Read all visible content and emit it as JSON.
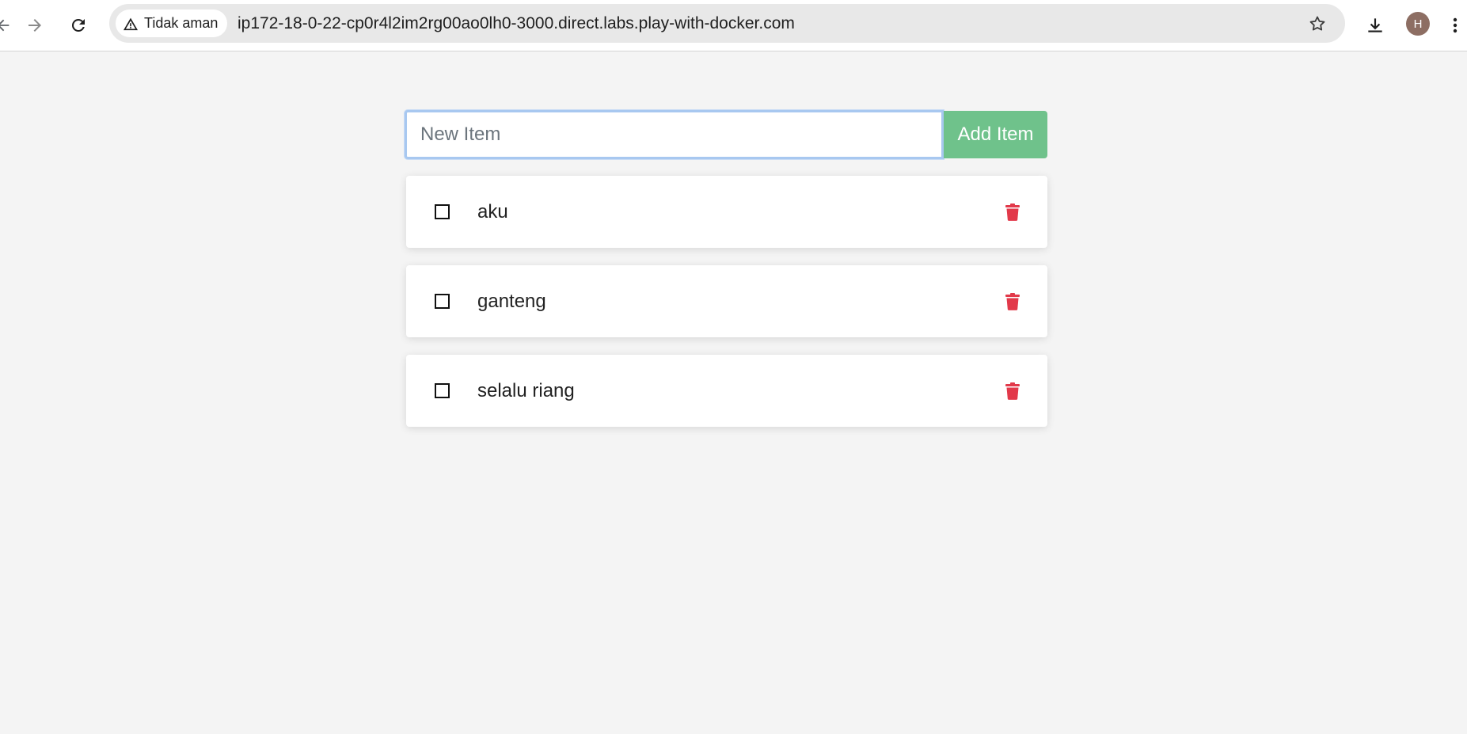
{
  "browser": {
    "security_label": "Tidak aman",
    "url": "ip172-18-0-22-cp0r4l2im2rg00ao0lh0-3000.direct.labs.play-with-docker.com",
    "avatar_initial": "H"
  },
  "form": {
    "input_placeholder": "New Item",
    "input_value": "",
    "add_button_label": "Add Item"
  },
  "items": [
    {
      "name": "aku",
      "completed": false
    },
    {
      "name": "ganteng",
      "completed": false
    },
    {
      "name": "selalu riang",
      "completed": false
    }
  ],
  "colors": {
    "add_button": "#6fc28b",
    "delete_icon": "#e2394a",
    "background": "#f4f4f4"
  }
}
